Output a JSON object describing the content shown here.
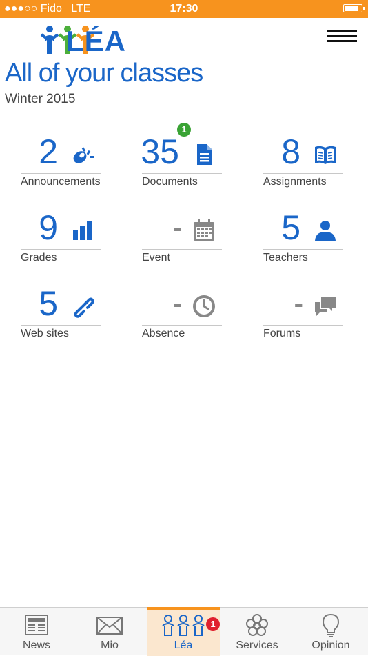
{
  "status_bar": {
    "carrier": "●●●○○ Fido",
    "network": "LTE",
    "time": "17:30",
    "battery_level": 0.9
  },
  "header": {
    "logo_text": "LÉA",
    "menu_icon": "hamburger-icon"
  },
  "page": {
    "title": "All of your classes",
    "session": "Winter 2015"
  },
  "tiles": [
    {
      "count": "2",
      "label": "Announcements",
      "icon": "megaphone-icon"
    },
    {
      "count": "35",
      "label": "Documents",
      "icon": "document-icon",
      "badge": "1"
    },
    {
      "count": "8",
      "label": "Assignments",
      "icon": "book-icon"
    },
    {
      "count": "9",
      "label": "Grades",
      "icon": "bar-chart-icon"
    },
    {
      "count": "-",
      "label": "Event",
      "icon": "calendar-icon"
    },
    {
      "count": "5",
      "label": "Teachers",
      "icon": "person-icon"
    },
    {
      "count": "5",
      "label": "Web sites",
      "icon": "link-icon"
    },
    {
      "count": "-",
      "label": "Absence",
      "icon": "clock-icon"
    },
    {
      "count": "-",
      "label": "Forums",
      "icon": "chat-bubbles-icon"
    }
  ],
  "tabbar": {
    "tabs": [
      {
        "label": "News",
        "icon": "newspaper-icon"
      },
      {
        "label": "Mio",
        "icon": "envelope-icon"
      },
      {
        "label": "Léa",
        "icon": "people-icon",
        "badge": "1",
        "active": true
      },
      {
        "label": "Services",
        "icon": "flower-icon"
      },
      {
        "label": "Opinion",
        "icon": "lightbulb-icon"
      }
    ]
  },
  "colors": {
    "accent": "#1a66c8",
    "status_bar": "#f7931e",
    "badge_green": "#3aa335",
    "badge_red": "#e0202e",
    "muted": "#888888"
  }
}
